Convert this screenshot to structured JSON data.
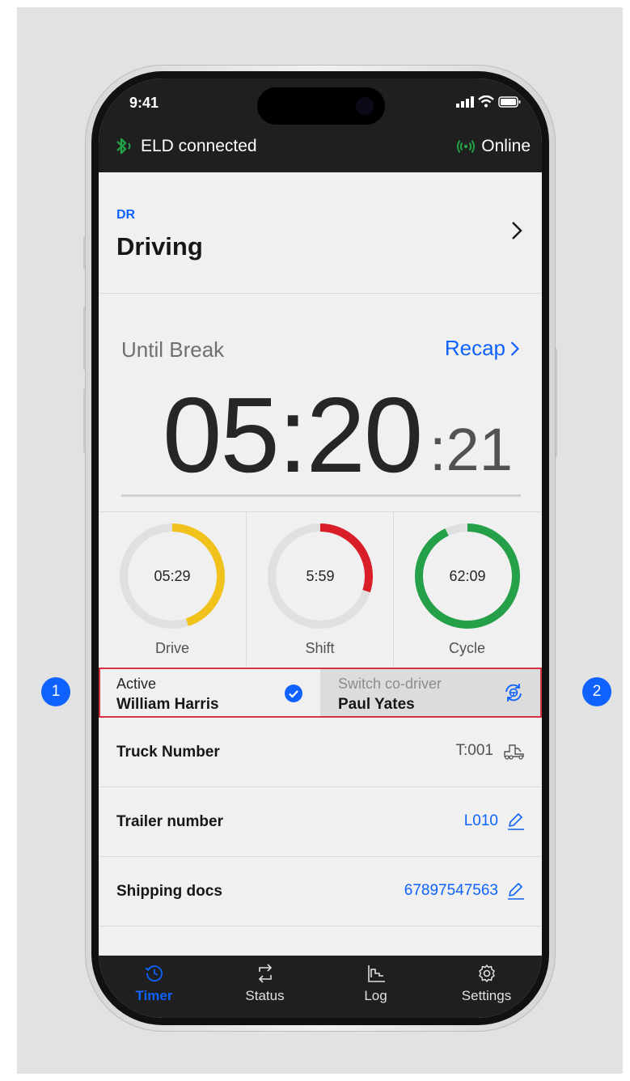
{
  "status_bar": {
    "time": "9:41"
  },
  "eld_bar": {
    "connection": "ELD connected",
    "network": "Online"
  },
  "duty_status": {
    "code": "DR",
    "label": "Driving"
  },
  "timer": {
    "label": "Until Break",
    "recap_label": "Recap",
    "main": "05:20",
    "seconds": ":21"
  },
  "gauges": [
    {
      "value": "05:29",
      "label": "Drive",
      "progress": 0.45,
      "color": "#f1c21b"
    },
    {
      "value": "5:59",
      "label": "Shift",
      "progress": 0.3,
      "color": "#da1e28"
    },
    {
      "value": "62:09",
      "label": "Cycle",
      "progress": 0.93,
      "color": "#24a148"
    }
  ],
  "drivers": {
    "active_label": "Active",
    "active_name": "William Harris",
    "switch_label": "Switch co-driver",
    "switch_name": "Paul Yates"
  },
  "info": {
    "truck_label": "Truck Number",
    "truck_value": "T:001",
    "trailer_label": "Trailer number",
    "trailer_value": "L010",
    "docs_label": "Shipping docs",
    "docs_value": "67897547563"
  },
  "tabs": [
    "Timer",
    "Status",
    "Log",
    "Settings"
  ],
  "badges": [
    "1",
    "2"
  ],
  "colors": {
    "accent": "#0f62fe",
    "highlight": "#d6343f"
  }
}
